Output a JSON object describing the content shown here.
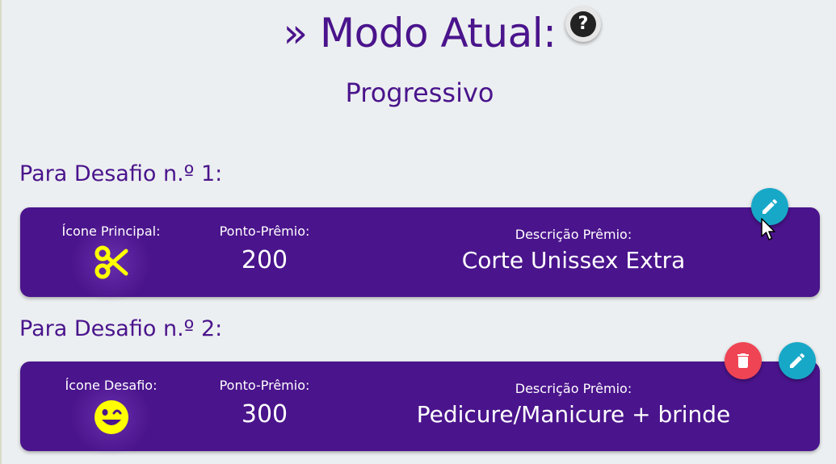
{
  "header": {
    "title": "» Modo Atual:",
    "help_icon_glyph": "?",
    "mode": "Progressivo"
  },
  "challenges": [
    {
      "section_title": "Para Desafio n.º 1:",
      "icon_label": "Ícone Principal:",
      "icon": "scissors-icon",
      "icon_color": "#ffff00",
      "points_label": "Ponto-Prêmio:",
      "points": "200",
      "description_label": "Descrição Prêmio:",
      "description": "Corte Unissex Extra",
      "actions": [
        "edit"
      ]
    },
    {
      "section_title": "Para Desafio n.º 2:",
      "icon_label": "Ícone Desafio:",
      "icon": "smile-icon",
      "icon_color": "#ffff00",
      "points_label": "Ponto-Prêmio:",
      "points": "300",
      "description_label": "Descrição Prêmio:",
      "description": "Pedicure/Manicure + brinde",
      "actions": [
        "delete",
        "edit"
      ]
    }
  ],
  "colors": {
    "primary": "#4a148c",
    "edit": "#17a8c8",
    "delete": "#ef4454",
    "background": "#eceff1"
  }
}
